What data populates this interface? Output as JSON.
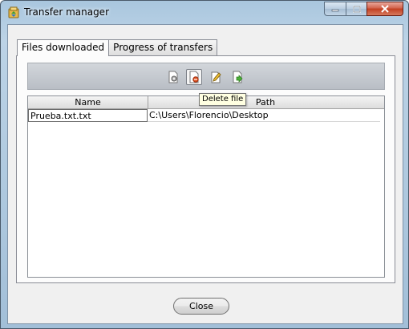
{
  "window": {
    "title": "Transfer manager",
    "icon": "transfer-manager-icon"
  },
  "tabs": [
    {
      "label": "Files downloaded",
      "active": true
    },
    {
      "label": "Progress of transfers",
      "active": false
    }
  ],
  "toolbar": {
    "buttons": [
      {
        "icon": "settings-document-icon",
        "name": "settings-button"
      },
      {
        "icon": "delete-file-icon",
        "name": "delete-file-button"
      },
      {
        "icon": "edit-file-icon",
        "name": "edit-file-button"
      },
      {
        "icon": "open-file-icon",
        "name": "open-file-button"
      }
    ],
    "tooltip": "Delete file"
  },
  "table": {
    "columns": [
      "Name",
      "Path"
    ],
    "rows": [
      {
        "name": "Prueba.txt.txt",
        "path": "C:\\Users\\Florencio\\Desktop"
      }
    ]
  },
  "footer": {
    "close_label": "Close"
  }
}
